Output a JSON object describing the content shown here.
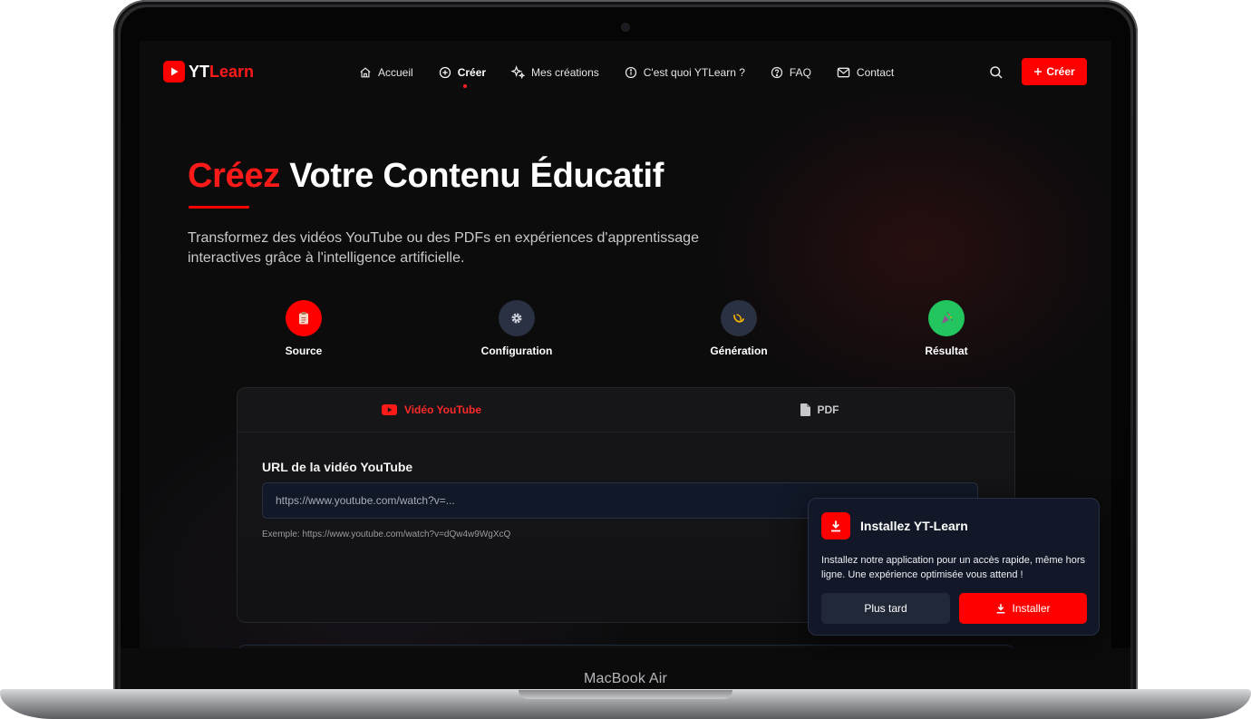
{
  "brand": {
    "name_main": "YT",
    "name_accent": "Learn"
  },
  "nav": {
    "items": [
      {
        "label": "Accueil",
        "icon": "home-icon"
      },
      {
        "label": "Créer",
        "icon": "plus-circle-icon",
        "active": true
      },
      {
        "label": "Mes créations",
        "icon": "sparkles-icon"
      },
      {
        "label": "C'est quoi YTLearn ?",
        "icon": "info-icon"
      },
      {
        "label": "FAQ",
        "icon": "help-circle-icon"
      },
      {
        "label": "Contact",
        "icon": "mail-icon"
      }
    ],
    "create_button": "Créer"
  },
  "hero": {
    "title_accent": "Créez",
    "title_rest": " Votre Contenu Éducatif",
    "subtitle": "Transformez des vidéos YouTube ou des PDFs en expériences d'apprentissage interactives grâce à l'intelligence artificielle."
  },
  "steps": [
    {
      "label": "Source",
      "icon": "clipboard-icon",
      "color": "#ff0000"
    },
    {
      "label": "Configuration",
      "icon": "gear-icon",
      "color": "#2a3142"
    },
    {
      "label": "Génération",
      "icon": "spinner-icon",
      "color": "#2a3142"
    },
    {
      "label": "Résultat",
      "icon": "party-icon",
      "color": "#22c55e"
    }
  ],
  "card": {
    "tabs": [
      {
        "label": "Vidéo YouTube",
        "icon": "youtube-icon",
        "active": true
      },
      {
        "label": "PDF",
        "icon": "file-icon",
        "active": false
      }
    ],
    "url_label": "URL de la vidéo YouTube",
    "url_placeholder": "https://www.youtube.com/watch?v=...",
    "url_value": "",
    "hint": "Exemple: https://www.youtube.com/watch?v=dQw4w9WgXcQ"
  },
  "install_popup": {
    "title": "Installez YT-Learn",
    "text": "Installez notre application pour un accès rapide, même hors ligne. Une expérience optimisée vous attend !",
    "later_button": "Plus tard",
    "install_button": "Installer"
  },
  "device": {
    "label": "MacBook Air"
  },
  "colors": {
    "accent": "#ff0000",
    "background": "#0c0c0d",
    "success": "#22c55e"
  }
}
